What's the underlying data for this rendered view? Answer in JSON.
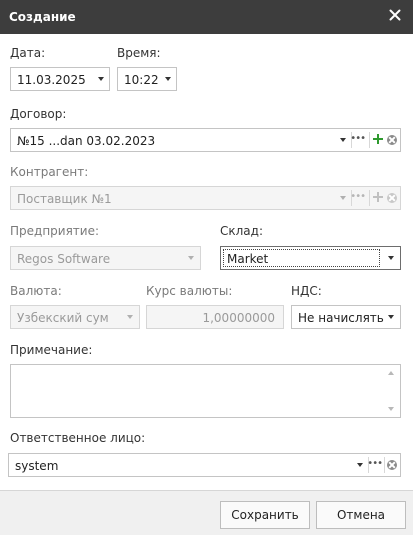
{
  "window": {
    "title": "Создание"
  },
  "date": {
    "label": "Дата:",
    "value": "11.03.2025"
  },
  "time": {
    "label": "Время:",
    "value": "10:22"
  },
  "contract": {
    "label": "Договор:",
    "value": "№15 ...dan 03.02.2023"
  },
  "counterparty": {
    "label": "Контрагент:",
    "value": "Поставщик №1"
  },
  "enterprise": {
    "label": "Предприятие:",
    "value": "Regos Software"
  },
  "warehouse": {
    "label": "Склад:",
    "value": "Market"
  },
  "currency": {
    "label": "Валюта:",
    "value": "Узбекский сум"
  },
  "rate": {
    "label": "Курс валюты:",
    "value": "1,00000000"
  },
  "vat": {
    "label": "НДС:",
    "value": "Не начислять"
  },
  "note": {
    "label": "Примечание:",
    "value": ""
  },
  "responsible": {
    "label": "Ответственное лицо:",
    "value": "system"
  },
  "buttons": {
    "save": "Сохранить",
    "cancel": "Отмена"
  },
  "colors": {
    "titlebar": "#3d3d3d",
    "add_green": "#2e9a2e",
    "footer_bg": "#f0f0f0"
  }
}
